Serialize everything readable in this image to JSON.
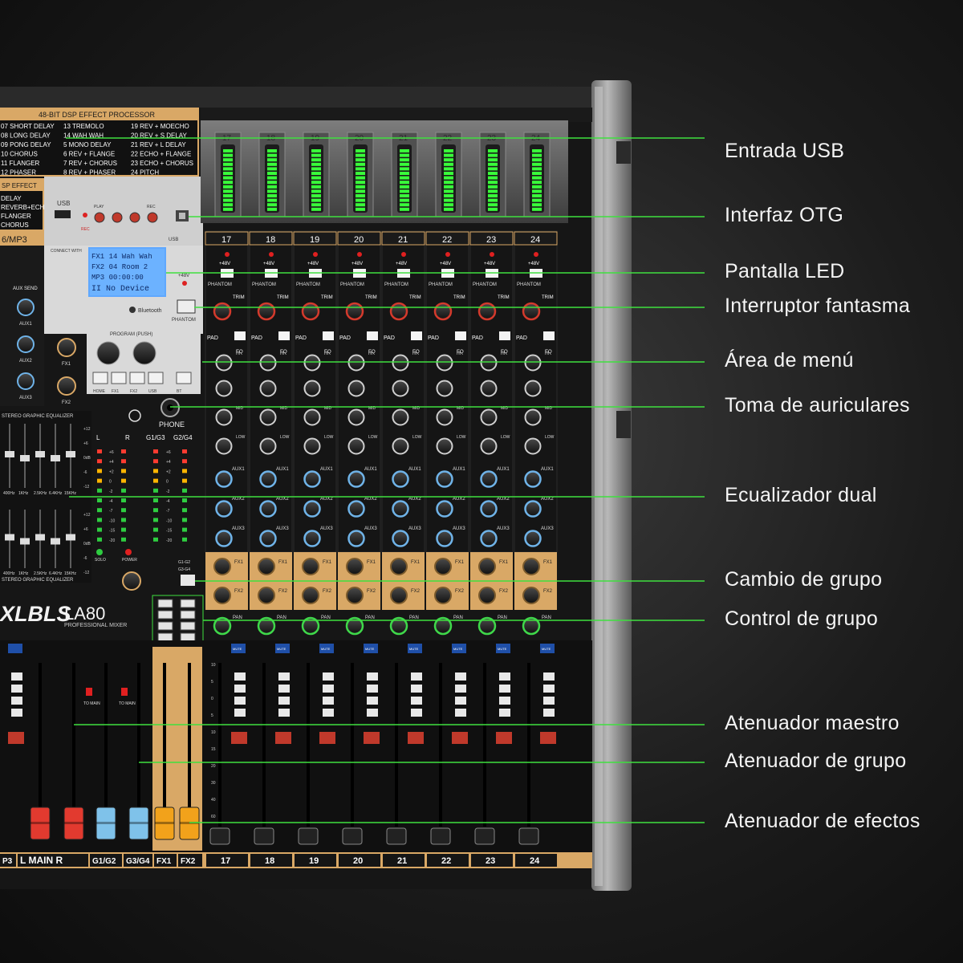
{
  "brand": {
    "logo": "XLBLS",
    "model": "LA80",
    "subtitle": "PROFESSIONAL MIXER"
  },
  "dsp_panel": {
    "title": "48-BIT DSP EFFECT PROCESSOR",
    "effects_col1": [
      "07 SHORT DELAY",
      "08 LONG DELAY",
      "09 PONG DELAY",
      "10 CHORUS",
      "11 FLANGER",
      "12 PHASER"
    ],
    "effects_col2": [
      "13 TREMOLO",
      "14 WAH WAH",
      "5 MONO DELAY",
      "6 REV + FLANGE",
      "7 REV + CHORUS",
      "8 REV + PHASER"
    ],
    "effects_col3": [
      "19 REV + MOECHO",
      "20 REV + S DELAY",
      "21 REV + L DELAY",
      "22 ECHO + FLANGE",
      "23 ECHO + CHORUS",
      "24 PITCH"
    ],
    "dsp_effect_title": "SP EFFECT",
    "dsp_effect_list": [
      "DELAY",
      "REVERB+ECHO",
      "FLANGER",
      "CHORUS"
    ],
    "mp3_label": "6/MP3"
  },
  "usb_section": {
    "usb_label": "USB",
    "transport": [
      "PLAY",
      "",
      "",
      "REC"
    ],
    "rec_label": "REC",
    "otg_label": "USB"
  },
  "display": {
    "line1": "FX1 14 Wah Wah",
    "line2": "FX2 04 Room 2",
    "line3": "MP3 00:00:00",
    "line4": "II No Device",
    "bluetooth_label": "Bluetooth",
    "connect_label": "CONNECT WITH"
  },
  "program": {
    "title": "PROGRAM (PUSH)",
    "buttons": [
      "HOME",
      "FX1",
      "FX2",
      "USB",
      "BT"
    ],
    "phantom_label": "PHANTOM",
    "phantom_voltage": "+48V",
    "fx_knobs": [
      "FX1",
      "FX2"
    ],
    "aux_send": "AUX SEND",
    "aux_knobs": [
      "AUX1",
      "AUX2",
      "AUX3"
    ]
  },
  "phone": {
    "label": "PHONE"
  },
  "geq": {
    "title": "STEREO GRAPHIC EQUALIZER",
    "bands": [
      "400Hz",
      "1KHz",
      "2.5KHz",
      "6.4KHz",
      "15KHz"
    ],
    "scale": [
      "+12",
      "+6",
      "0dB",
      "-6",
      "-12"
    ]
  },
  "master_meter": {
    "headers": [
      "L",
      "R",
      "G1/G3",
      "G2/G4"
    ],
    "scale": [
      "+6",
      "+4",
      "+2",
      "0",
      "-2",
      "-4",
      "-7",
      "-10",
      "-15",
      "-20"
    ],
    "solo_label": "SOLO",
    "power_label": "POWER"
  },
  "group_switch": {
    "labels": [
      "G1-G2",
      "G3-G4"
    ]
  },
  "channels": {
    "numbers": [
      "17",
      "18",
      "19",
      "20",
      "21",
      "22",
      "23",
      "24"
    ],
    "phantom": "+48V",
    "phantom_label": "PHANTOM",
    "trim": "TRIM",
    "pad": "PAD",
    "eq": "EQ",
    "hi": "HI",
    "mid": "MID",
    "low": "LOW",
    "aux": [
      "AUX1",
      "AUX2",
      "AUX3"
    ],
    "fx": [
      "FX1",
      "FX2"
    ],
    "pan": "PAN",
    "mute": "MUTE"
  },
  "bottom_labels": {
    "left_cut": "P3",
    "main": "L  MAIN  R",
    "groups": [
      "G1/G2",
      "G3/G4"
    ],
    "fx": [
      "FX1",
      "FX2"
    ],
    "to_main": "TO MAIN"
  },
  "fader_scale": [
    "10",
    "5",
    "0",
    "5",
    "10",
    "15",
    "20",
    "30",
    "40",
    "60"
  ],
  "callouts": [
    {
      "label": "Entrada USB"
    },
    {
      "label": "Interfaz OTG"
    },
    {
      "label": "Pantalla LED"
    },
    {
      "label": "Interruptor fantasma"
    },
    {
      "label": "Área de menú"
    },
    {
      "label": "Toma de auriculares"
    },
    {
      "label": "Ecualizador dual"
    },
    {
      "label": "Cambio de grupo"
    },
    {
      "label": "Control de grupo"
    },
    {
      "label": "Atenuador maestro"
    },
    {
      "label": "Atenuador de grupo"
    },
    {
      "label": "Atenuador de efectos"
    }
  ],
  "colors": {
    "callout_line": "#3fe03f",
    "meter_green": "#39ff3a",
    "accent_gold": "#d9a866",
    "main_fader": "#e23a2f",
    "group_fader": "#7fc2ea",
    "fx_fader": "#f2a21b"
  }
}
